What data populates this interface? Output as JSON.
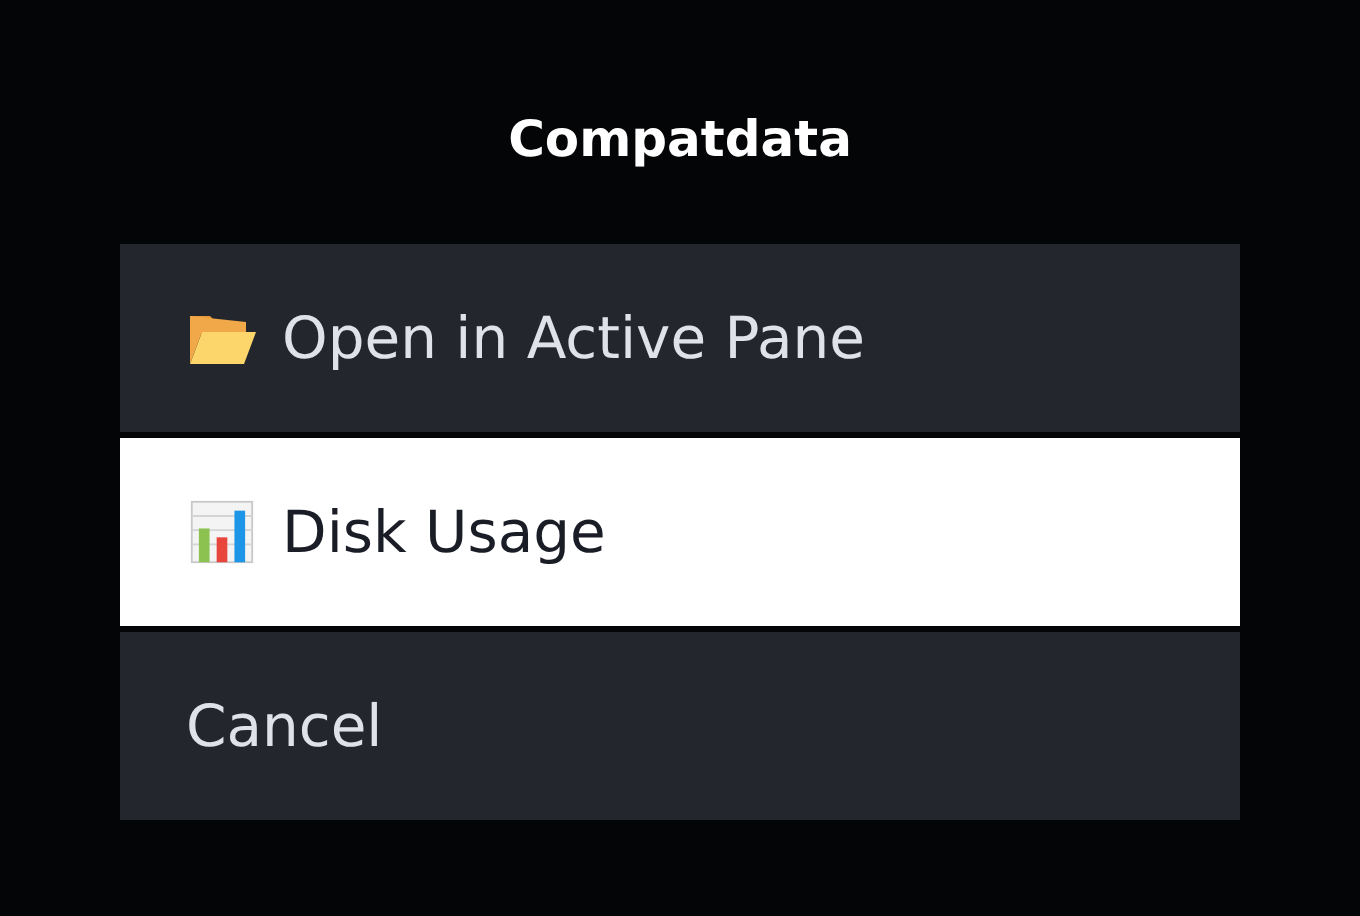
{
  "dialog": {
    "title": "Compatdata"
  },
  "menu": {
    "items": [
      {
        "label": "Open in Active Pane",
        "kind": "folder",
        "selected": false
      },
      {
        "label": "Disk Usage",
        "kind": "chart",
        "selected": true
      },
      {
        "label": "Cancel",
        "kind": "plain",
        "selected": false
      }
    ]
  }
}
